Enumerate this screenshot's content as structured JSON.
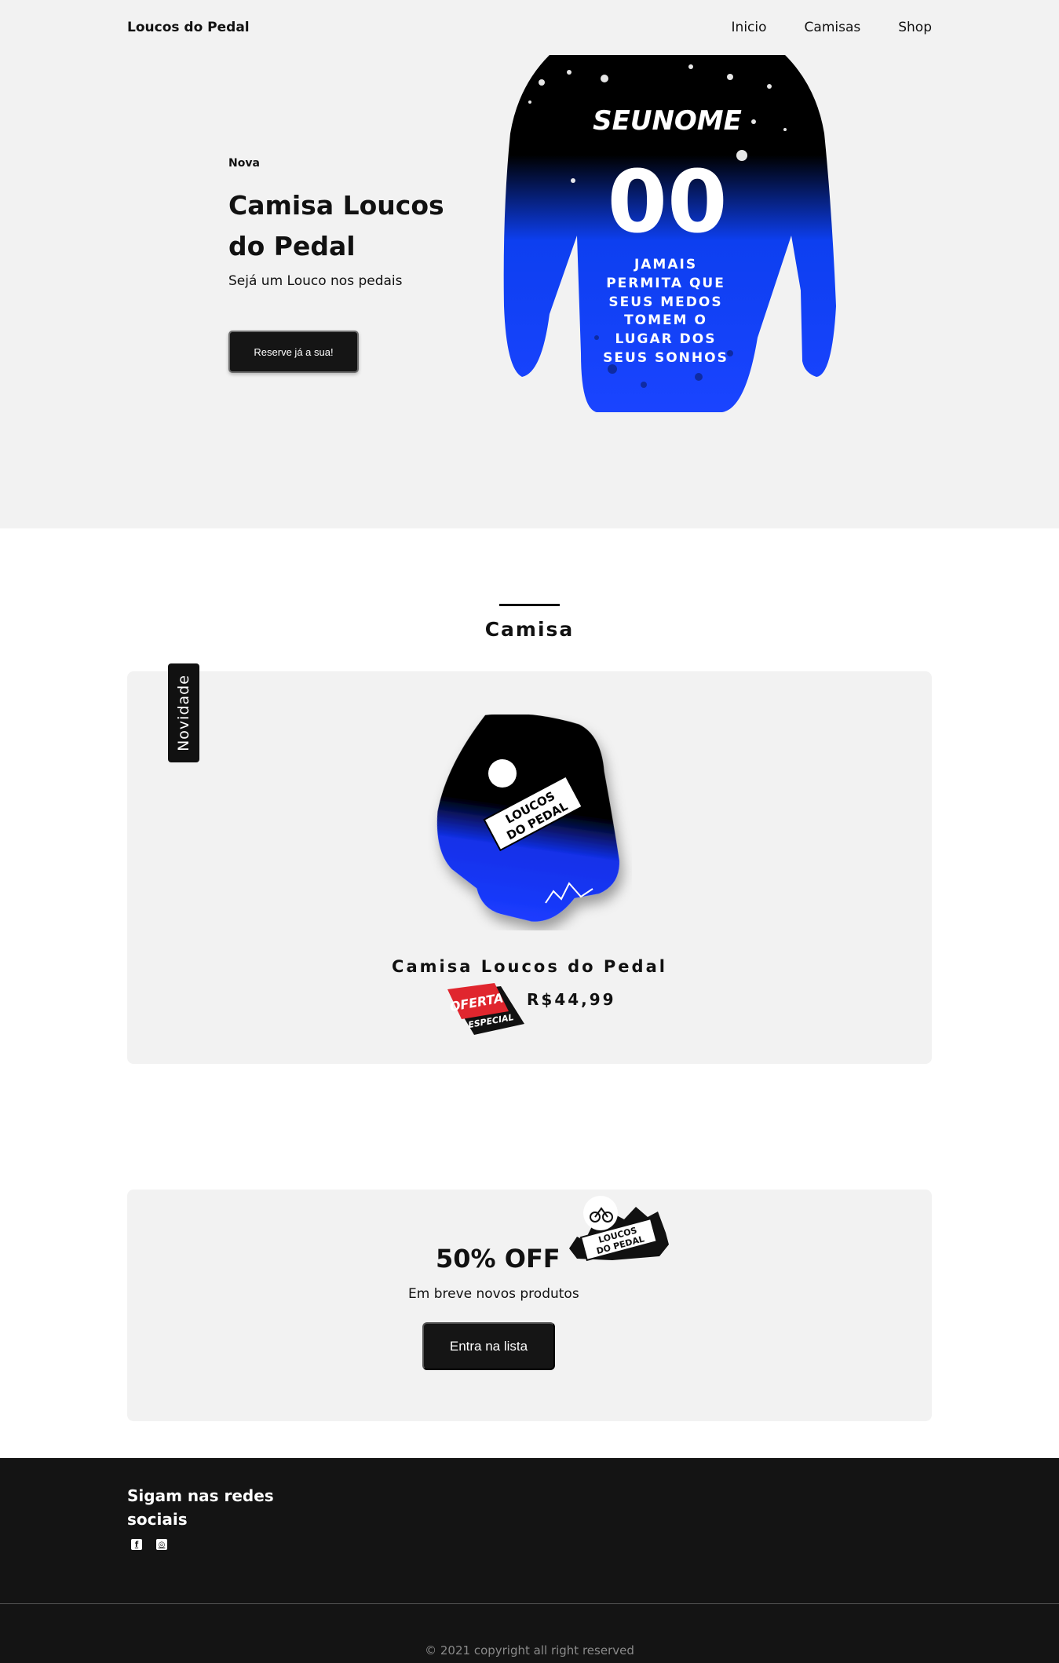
{
  "nav": {
    "brand": "Loucos do Pedal",
    "links": [
      "Inicio",
      "Camisas",
      "Shop"
    ]
  },
  "hero": {
    "tag": "Nova",
    "title": "Camisa Loucos do Pedal",
    "subtitle": "Sejá um Louco nos pedais",
    "button": "Reserve já a sua!",
    "shirt_text": {
      "name": "SEUNOME",
      "number": "00",
      "slogan": [
        "JAMAIS",
        "PERMITA QUE",
        "SEUS MEDOS",
        "TOMEM O",
        "LUGAR DOS",
        "SEUS SONHOS"
      ]
    }
  },
  "products": {
    "section_title": "Camisa",
    "badge": "Novidade",
    "items": [
      {
        "name": "Camisa Loucos do Pedal",
        "price": "R$44,99",
        "sticker": [
          "OFERTA",
          "ESPECIAL"
        ],
        "print": [
          "LOUCOS",
          "DO PEDAL"
        ]
      }
    ]
  },
  "promo": {
    "title": "50% OFF",
    "subtitle": "Em breve novos produtos",
    "button": "Entra na lista",
    "logo_text": [
      "LOUCOS",
      "DO PEDAL"
    ]
  },
  "footer": {
    "title": "Sigam nas redes sociais",
    "socials": [
      "facebook-icon",
      "instagram-icon"
    ],
    "copyright": "© 2021 copyright all right reserved"
  },
  "colors": {
    "dark": "#141414",
    "light_bg": "#f2f2f2",
    "shirt_blue": "#1a3cff",
    "sticker_red": "#e0262e"
  }
}
